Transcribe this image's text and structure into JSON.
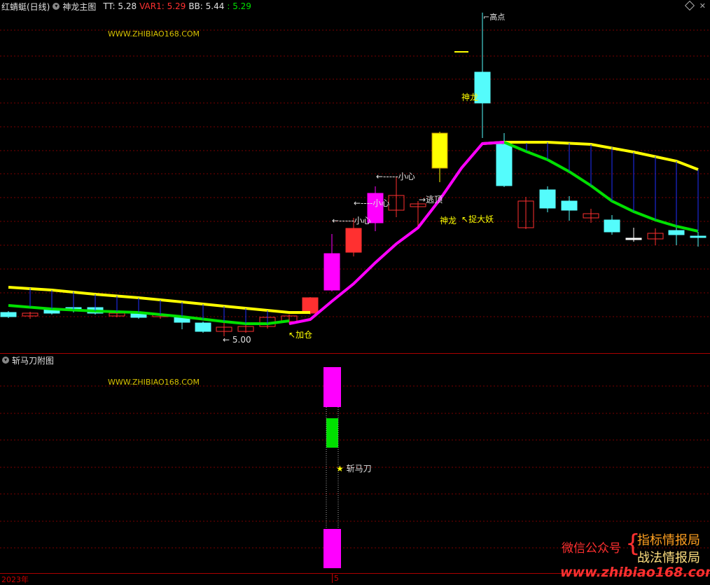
{
  "main_panel": {
    "title": "红蜻蜓(日线)",
    "indicator": "神龙主图",
    "tt_label": "TT: 5.28",
    "var1_label": "VAR1: 5.29",
    "bb_label": "BB: 5.44",
    "extra_label": ": 5.29",
    "watermark": "WWW.ZHIBIAO168.COM",
    "annotations": {
      "low_price": "5.00",
      "add_position": "加仓",
      "careful_1": "小心",
      "careful_2": "小心",
      "careful_3": "小心",
      "escape_top": "逃顶",
      "shenlong_1": "神龙",
      "catch_demon": "捉大妖",
      "shenlong_2": "神龙",
      "top_marker": "高点"
    }
  },
  "sub_panel": {
    "title": "斩马刀附图",
    "watermark": "WWW.ZHIBIAO168.COM",
    "signal_label": "斩马刀"
  },
  "time_axis": {
    "year_label": "2023年",
    "month_label": "5"
  },
  "promo": {
    "wechat": "微信公众号",
    "line1": "指标情报局",
    "line2": "战法情报局",
    "site": "www.zhibiao168.com"
  },
  "colors": {
    "up": "#ff3030",
    "down": "#54fcfc",
    "yellow_line": "#ffff00",
    "green_line": "#00e000",
    "magenta_line": "#ff00ff",
    "grid": "#7a0000"
  }
}
